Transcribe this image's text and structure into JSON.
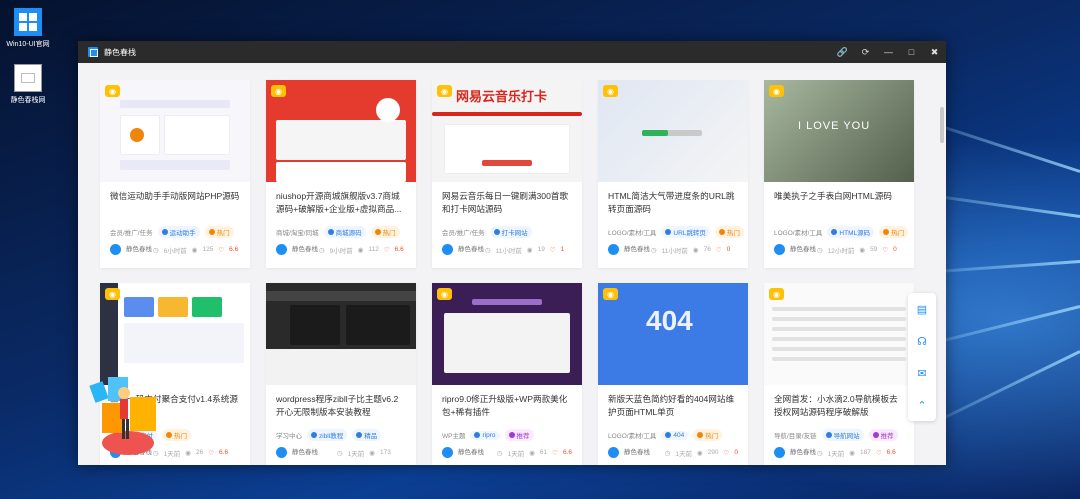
{
  "desktop": {
    "icons": [
      {
        "label": "Win10-UI官网"
      },
      {
        "label": "静色春栈网"
      }
    ]
  },
  "window": {
    "title": "静色春栈",
    "buttons": [
      "link-icon",
      "refresh-icon",
      "minimize-icon",
      "maximize-icon",
      "close-icon"
    ]
  },
  "colors": {
    "accent": "#1e8ef5",
    "hot": "#f0850c",
    "like": "#f04e23",
    "badge": "#ffc107"
  },
  "cards": [
    {
      "title": "微信运动助手手动版网站PHP源码",
      "category": "会员/推广/任务",
      "tag": "运动助手",
      "tag2": "热门",
      "author": "静色春栈",
      "time": "6小时前",
      "views": "125",
      "likes": "6.6"
    },
    {
      "title": "niushop开源商城旗舰版v3.7商城源码+破解版+企业版+虚拟商品...",
      "category": "商城/淘宝/同城",
      "tag": "商城源码",
      "tag2": "热门",
      "author": "静色春栈",
      "time": "9小时前",
      "views": "112",
      "likes": "6.6"
    },
    {
      "title": "网易云音乐每日一键刷满300首歌和打卡网站源码",
      "category": "会员/推广/任务",
      "tag": "打卡网站",
      "tag2": "",
      "author": "静色春栈",
      "time": "11小时前",
      "views": "19",
      "likes": "1",
      "thumb_text": "网易云音乐打卡"
    },
    {
      "title": "HTML简洁大气带进度条的URL跳转页面源码",
      "category": "LOGO/素材/工具",
      "tag": "URL跳转页",
      "tag2": "热门",
      "author": "静色春栈",
      "time": "11小时前",
      "views": "76",
      "likes": "0"
    },
    {
      "title": "唯美执子之手表白网HTML源码",
      "category": "LOGO/素材/工具",
      "tag": "HTML源码",
      "tag2": "热门",
      "author": "静色春栈",
      "time": "12小时前",
      "views": "59",
      "likes": "0",
      "thumb_text": "I LOVE YOU"
    },
    {
      "title": "三合一码支付聚合支付v1.4系统源码",
      "category": "",
      "tag": "聚合支付",
      "tag2": "热门",
      "author": "静色春栈",
      "time": "1天前",
      "views": "26",
      "likes": "6.6"
    },
    {
      "title": "wordpress程序zibll子比主题v6.2开心无限制版本安装教程",
      "category": "学习中心",
      "tag": "zibll教程",
      "tag2": "精品",
      "author": "静色春栈",
      "time": "1天前",
      "views": "173",
      "likes": ""
    },
    {
      "title": "ripro9.0修正升级版+WP两款美化包+稀有插件",
      "category": "WP主题",
      "tag": "ripro",
      "tag2": "推荐",
      "author": "静色春栈",
      "time": "1天前",
      "views": "61",
      "likes": "6.6"
    },
    {
      "title": "新版天蓝色简约好看的404网站维护页面HTML单页",
      "category": "LOGO/素材/工具",
      "tag": "404",
      "tag2": "热门",
      "author": "静色春栈",
      "time": "1天前",
      "views": "290",
      "likes": "0",
      "thumb_text": "404"
    },
    {
      "title": "全网首发：小水滴2.0导航模板去授权网站源码程序破解版",
      "category": "导航/目录/友链",
      "tag": "导航网站",
      "tag2": "推荐",
      "author": "静色春栈",
      "time": "1天前",
      "views": "187",
      "likes": "6.6"
    }
  ],
  "side_tools": [
    "calendar-icon",
    "headset-icon",
    "chat-icon",
    "top-icon"
  ]
}
